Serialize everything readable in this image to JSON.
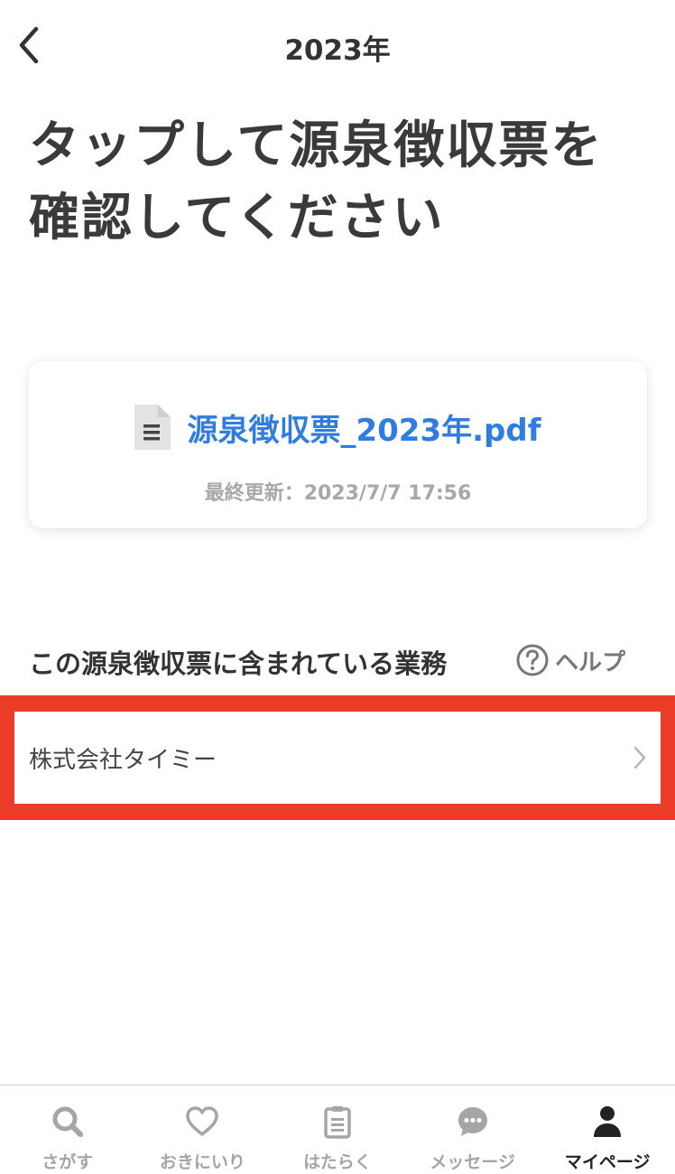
{
  "header": {
    "title": "2023年",
    "back_icon": "chevron-left-icon"
  },
  "main": {
    "title": "タップして源泉徴収票を確認してください",
    "file": {
      "name": "源泉徴収票_2023年.pdf",
      "updated": "最終更新：2023/7/7 17:56",
      "icon": "document-icon",
      "link_color": "#2f7de1"
    },
    "section_title": "この源泉徴収票に含まれている業務",
    "help_label": "ヘルプ",
    "companies": [
      {
        "name": "株式会社タイミー"
      }
    ],
    "highlight_color": "#ea3c26"
  },
  "tabbar": {
    "items": [
      {
        "label": "さがす",
        "icon": "search-icon",
        "active": false
      },
      {
        "label": "おきにいり",
        "icon": "heart-icon",
        "active": false
      },
      {
        "label": "はたらく",
        "icon": "clipboard-icon",
        "active": false
      },
      {
        "label": "メッセージ",
        "icon": "chat-bubble-icon",
        "active": false
      },
      {
        "label": "マイページ",
        "icon": "person-icon",
        "active": true
      }
    ]
  }
}
